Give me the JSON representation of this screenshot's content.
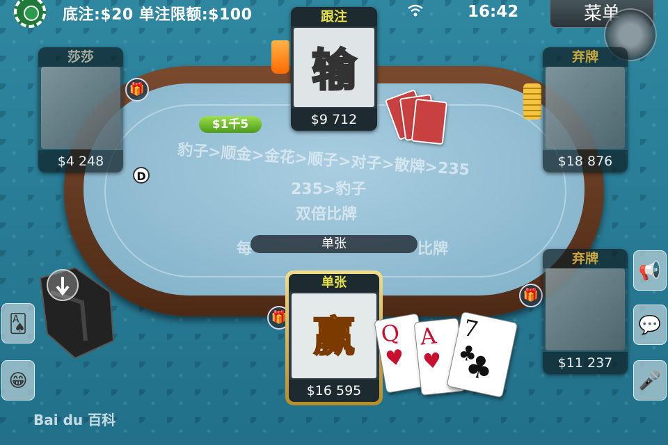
{
  "status_bar": {
    "bet_info": "底注:$20  单注限额:$100",
    "clock": "16:42",
    "menu_label": "菜单"
  },
  "table": {
    "rule_hierarchy": "豹子>顺金>金花>顺子>对子>散牌>235",
    "rule_235": "235>豹子",
    "rule_double": "双倍比牌",
    "rule_bottom": "每",
    "rule_bottom_right": "比牌",
    "banner": "单张",
    "pot_badge": "$1千5",
    "dealer_label": "D"
  },
  "players": {
    "left": {
      "name": "莎莎",
      "money": "$4 248"
    },
    "top": {
      "status": "跟注",
      "result": "输",
      "money": "$9 712"
    },
    "right_top": {
      "status": "弃牌",
      "money": "$18 876"
    },
    "right_bottom": {
      "status": "弃牌",
      "money": "$11 237"
    },
    "me": {
      "status": "单张",
      "result": "赢",
      "money": "$16 595"
    }
  },
  "my_cards": [
    {
      "rank": "Q",
      "suit": "♥"
    },
    {
      "rank": "A",
      "suit": "♥"
    },
    {
      "rank": "7",
      "suit": "♣"
    }
  ],
  "watermark": "Bai du 百科",
  "icons": [
    "wifi-icon",
    "chip-icon",
    "gift-icon",
    "coin-stack-icon",
    "drink-icon",
    "chair-icon",
    "megaphone-icon",
    "chat-icon",
    "microphone-icon",
    "emoji-icon",
    "cards-icon",
    "download-arrow-icon"
  ]
}
